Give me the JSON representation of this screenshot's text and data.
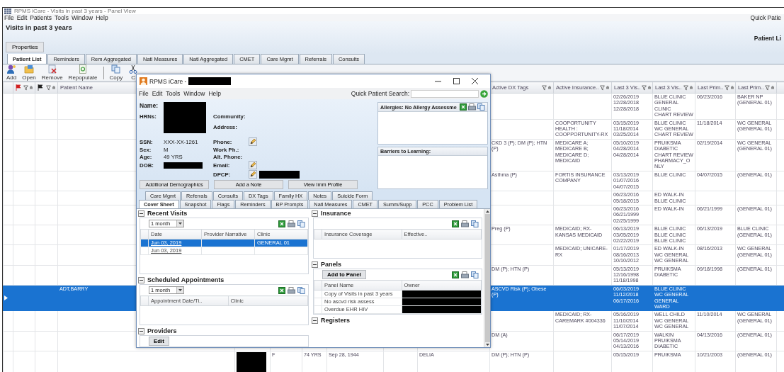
{
  "window": {
    "title": "RPMS iCare - Visits in past 3 years - Panel View"
  },
  "menu": [
    "File",
    "Edit",
    "Patients",
    "Tools",
    "Window",
    "Help"
  ],
  "quick_patient_search_label": "Quick Patie",
  "panel_title": "Visits in past 3 years",
  "panel_list_label": "Patient Li",
  "properties_button": "Properties",
  "tabs": [
    {
      "label": "Patient List",
      "selected": true
    },
    {
      "label": "Reminders",
      "selected": false
    },
    {
      "label": "Rem Aggregated",
      "selected": false
    },
    {
      "label": "Natl Measures",
      "selected": false
    },
    {
      "label": "Natl Aggregated",
      "selected": false
    },
    {
      "label": "CMET",
      "selected": false
    },
    {
      "label": "Care Mgmt",
      "selected": false
    },
    {
      "label": "Referrals",
      "selected": false
    },
    {
      "label": "Consults",
      "selected": false
    }
  ],
  "toolbar": [
    {
      "label": "Add",
      "kind": "add"
    },
    {
      "label": "Open",
      "kind": "open"
    },
    {
      "label": "Remove",
      "kind": "remove"
    },
    {
      "label": "Repopulate",
      "kind": "repopulate"
    },
    {
      "label": "Copy",
      "kind": "copy"
    },
    {
      "label": "C",
      "kind": "cut"
    }
  ],
  "grid": {
    "columns": [
      "Patient Name",
      "Active DX Tags",
      "Active Insurance..",
      "Last 3 Vis..",
      "Last 3 Vis..",
      "Last Prim..",
      "Last Prim.."
    ],
    "rows": [
      {
        "selected": false,
        "last_3_visit_dates": [
          "02/26/2019",
          "12/28/2018",
          "12/28/2018"
        ],
        "last_3_visit_clinics": [
          "BLUE CLINIC",
          "GENERAL CLINIC",
          "CHART REVIEW"
        ],
        "last_primary_date": "06/23/2016",
        "last_primary_provider": "BAKER NP (GENERAL 01)"
      },
      {
        "selected": false,
        "active_insurance": "COOPORTUNITY HEALTH : COOPPORTUNITY-RX",
        "last_3_visit_dates": [
          "03/15/2019",
          "11/18/2014",
          "03/25/2014"
        ],
        "last_3_visit_clinics": [
          "BLUE CLINIC",
          "WC GENERAL",
          "CHART REVIEW"
        ],
        "last_primary_date": "11/18/2014",
        "last_primary_provider": "WC GENERAL (GENERAL 01)"
      },
      {
        "selected": false,
        "active_dx_tags": "CKD 3 (P); DM (P); HTN (P)",
        "active_insurance": "MEDICARE A; MEDICARE B; MEDICARE D; MEDICAID",
        "last_3_visit_dates": [
          "05/10/2019",
          "04/28/2014",
          "04/28/2014"
        ],
        "last_3_visit_clinics": [
          "PRUIKSMA DIABETIC",
          "CHART REVIEW",
          "PHARMACY_ONLY"
        ],
        "last_primary_date": "02/19/2014",
        "last_primary_provider": "WC GENERAL (GENERAL 01)"
      },
      {
        "selected": false,
        "active_dx_tags": "Asthma (P)",
        "active_insurance": "FORTIS INSURANCE COMPANY",
        "last_3_visit_dates": [
          "03/13/2019",
          "01/07/2016",
          "04/07/2015"
        ],
        "last_3_visit_clinics": [
          "BLUE CLINIC"
        ],
        "last_primary_date": "04/07/2015",
        "last_primary_provider": "(GENERAL 01)"
      },
      {
        "selected": false,
        "last_3_visit_dates": [
          "06/23/2016",
          "05/18/2015"
        ],
        "last_3_visit_clinics": [
          "ED WALK-IN",
          "BLUE CLINIC"
        ]
      },
      {
        "selected": false,
        "last_3_visit_dates": [
          "06/23/2016",
          "06/21/1999",
          "02/25/1999"
        ],
        "last_3_visit_clinics": [
          "ED WALK-IN"
        ],
        "last_primary_date": "06/21/1999",
        "last_primary_provider": "(GENERAL 01)"
      },
      {
        "selected": false,
        "active_dx_tags": "Preg (P)",
        "active_insurance": "MEDICAID; RX-KANSAS MEDICAID",
        "last_3_visit_dates": [
          "06/13/2019",
          "03/05/2019",
          "02/22/2019"
        ],
        "last_3_visit_clinics": [
          "BLUE CLINIC",
          "BLUE CLINIC",
          "BLUE CLINIC"
        ],
        "last_primary_date": "06/13/2019",
        "last_primary_provider": "BLUE CLINIC (GENERAL 01)"
      },
      {
        "selected": false,
        "active_insurance": "MEDICAID; UNICARE-RX",
        "last_3_visit_dates": [
          "01/17/2019",
          "08/16/2013",
          "10/10/2012"
        ],
        "last_3_visit_clinics": [
          "ED WALK-IN",
          "WC GENERAL",
          "WC GENERAL"
        ],
        "last_primary_date": "08/16/2013",
        "last_primary_provider": "WC GENERAL (GENERAL 01)"
      },
      {
        "selected": false,
        "active_dx_tags": "DM (P); HTN (P)",
        "last_3_visit_dates": [
          "05/13/2019",
          "12/16/1998",
          "11/18/1998"
        ],
        "last_3_visit_clinics": [
          "PRUIKSMA DIABETIC"
        ],
        "last_primary_date": "09/18/1998",
        "last_primary_provider": "(GENERAL 01)"
      },
      {
        "selected": true,
        "patient_name": "ADT,BARRY",
        "active_dx_tags": "ASCVD Risk (P); Obese (P)",
        "last_3_visit_dates": [
          "06/03/2019",
          "11/12/2018",
          "06/17/2016"
        ],
        "last_3_visit_clinics": [
          "BLUE CLINIC",
          "WC GENERAL",
          "GENERAL WARD"
        ]
      },
      {
        "selected": false,
        "active_insurance": "MEDICAID; RX-CAREMARK #004336",
        "last_3_visit_dates": [
          "05/16/2019",
          "11/10/2014",
          "11/07/2014"
        ],
        "last_3_visit_clinics": [
          "WELL CHILD",
          "WC GENERAL",
          "WC GENERAL"
        ],
        "last_primary_date": "11/10/2014",
        "last_primary_provider": "WC GENERAL (GENERAL 01)"
      },
      {
        "selected": false,
        "active_dx_tags": "DM (A)",
        "last_3_visit_dates": [
          "06/17/2019",
          "05/14/2019",
          "04/13/2016"
        ],
        "last_3_visit_clinics": [
          "WALKIN",
          "PRUIKSMA DIABETIC"
        ],
        "last_primary_date": "04/13/2016",
        "last_primary_provider": "(GENERAL 01)"
      },
      {
        "selected": false,
        "redacted": true,
        "column_5": "F",
        "column_6": "74 YRS",
        "column_7": "Sep 28, 1944",
        "column_9": "DELIA",
        "active_dx_tags": "DM (P); HTN (P)",
        "last_3_visit_dates": [
          "05/15/2019"
        ],
        "last_3_visit_clinics": [
          "PRUIKSMA"
        ],
        "last_primary_date": "10/21/2003",
        "last_primary_provider": "(GENERAL 01)"
      }
    ]
  },
  "patient_window": {
    "title": "RPMS iCare -",
    "menu": [
      "File",
      "Edit",
      "Tools",
      "Window",
      "Help"
    ],
    "quick_patient_search_label": "Quick Patient Search:",
    "name_label": "Name:",
    "hrns_label": "HRNs:",
    "community_label": "Community:",
    "address_label": "Address:",
    "fields": [
      {
        "label": "SSN:",
        "value": "XXX-XX-1261"
      },
      {
        "label": "Sex:",
        "value": "M"
      },
      {
        "label": "Age:",
        "value": "49 YRS"
      },
      {
        "label": "DOB:",
        "redacted": true
      }
    ],
    "contacts": [
      {
        "label": "Phone:",
        "editable": true
      },
      {
        "label": "Work Ph.:",
        "editable": false
      },
      {
        "label": "Alt. Phone:",
        "editable": false
      },
      {
        "label": "Email:",
        "editable": true
      },
      {
        "label": "DPCP:",
        "editable": true,
        "redacted": true
      }
    ],
    "buttons": [
      "Additional Demographics",
      "Add a Note",
      "View Imm Profile"
    ],
    "allergies_title": "Allergies: No Allergy Assessme",
    "barriers_title": "Barriers to Learning:",
    "tab_rows": [
      [
        {
          "label": "Care Mgmt",
          "selected": false
        },
        {
          "label": "Referrals",
          "selected": false
        },
        {
          "label": "Consults",
          "selected": false
        },
        {
          "label": "DX Tags",
          "selected": false
        },
        {
          "label": "Family HX",
          "selected": false
        },
        {
          "label": "Notes",
          "selected": false
        },
        {
          "label": "Suicide Form",
          "selected": false
        }
      ],
      [
        {
          "label": "Cover Sheet",
          "selected": true
        },
        {
          "label": "Snapshot",
          "selected": false
        },
        {
          "label": "Flags",
          "selected": false
        },
        {
          "label": "Reminders",
          "selected": false
        },
        {
          "label": "BP Prompts",
          "selected": false
        },
        {
          "label": "Natl Measures",
          "selected": false
        },
        {
          "label": "CMET",
          "selected": false
        },
        {
          "label": "Summ/Supp",
          "selected": false
        },
        {
          "label": "PCC",
          "selected": false
        },
        {
          "label": "Problem List",
          "selected": false
        }
      ]
    ],
    "cover_sheet": {
      "left": [
        {
          "title": "Recent Visits",
          "dropdown": "1 month",
          "columns": [
            "Date",
            "Provider Narrative",
            "Clinic"
          ],
          "rows": [
            {
              "cells": [
                "Jun 03, 2019",
                null,
                "GENERAL 01"
              ],
              "selected": true
            },
            {
              "cells": [
                "Jun 03, 2019",
                null,
                null
              ],
              "selected": false
            }
          ]
        },
        {
          "title": "Scheduled Appointments",
          "dropdown": "1 month",
          "columns": [
            "Appointment Date/Ti..",
            "Clinic"
          ]
        },
        {
          "title": "Providers",
          "button": "Edit"
        }
      ],
      "right": [
        {
          "title": "Insurance",
          "columns": [
            "Insurance Coverage",
            "Effective.."
          ]
        },
        {
          "title": "Panels",
          "button": "Add to Panel",
          "columns": [
            "Panel Name",
            "Owner"
          ],
          "rows": [
            {
              "cells": [
                "Copy of Visits in past 3 years",
                null
              ],
              "selected": false,
              "redacted": true
            },
            {
              "cells": [
                "No ascvd risk assess",
                null
              ],
              "selected": false,
              "redacted": true
            },
            {
              "cells": [
                "Overdue EHR HIV",
                null
              ],
              "selected": false,
              "redacted": true
            }
          ]
        },
        {
          "title": "Registers"
        }
      ]
    }
  }
}
